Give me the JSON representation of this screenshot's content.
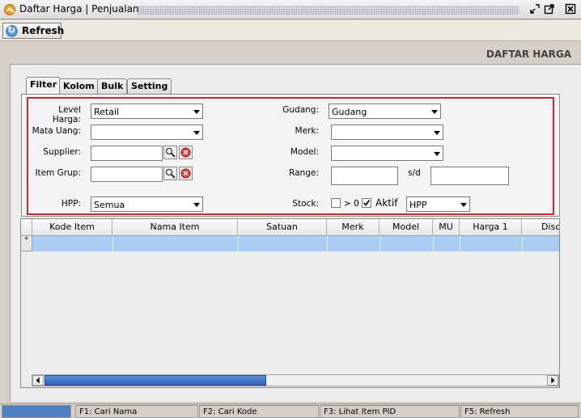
{
  "window": {
    "title": "Daftar Harga | Penjualan"
  },
  "toolbar": {
    "refresh_label": "Refresh"
  },
  "page_title": "DAFTAR HARGA",
  "tabs": [
    {
      "label": "Filter",
      "active": true
    },
    {
      "label": "Kolom",
      "active": false
    },
    {
      "label": "Bulk",
      "active": false
    },
    {
      "label": "Setting",
      "active": false
    }
  ],
  "filter": {
    "level_harga": {
      "label": "Level Harga:",
      "value": "Retail"
    },
    "mata_uang": {
      "label": "Mata Uang:",
      "value": ""
    },
    "supplier": {
      "label": "Supplier:",
      "value": ""
    },
    "item_grup": {
      "label": "Item Grup:",
      "value": ""
    },
    "hpp": {
      "label": "HPP:",
      "value": "Semua"
    },
    "gudang": {
      "label": "Gudang:",
      "value": "Gudang"
    },
    "merk": {
      "label": "Merk:",
      "value": ""
    },
    "model": {
      "label": "Model:",
      "value": ""
    },
    "range": {
      "label": "Range:",
      "sep": "s/d",
      "from": "",
      "to": ""
    },
    "stock": {
      "label": "Stock:",
      "gt0_label": "> 0",
      "gt0_checked": false,
      "aktif_label": "Aktif",
      "aktif_checked": true,
      "mode_value": "HPP"
    }
  },
  "grid": {
    "columns": [
      "Kode Item",
      "Nama Item",
      "Satuan",
      "Merk",
      "Model",
      "MU",
      "Harga 1",
      "Disc"
    ],
    "new_row_marker": "*"
  },
  "status": {
    "f1": "F1: Cari Nama",
    "f2": "F2: Cari Kode",
    "f3": "F3: Lihat Item PID",
    "f5": "F5: Refresh"
  },
  "colors": {
    "highlight_border": "#d8232a",
    "selection_row": "#a9cdf5",
    "status_accent": "#4f7fc4"
  }
}
